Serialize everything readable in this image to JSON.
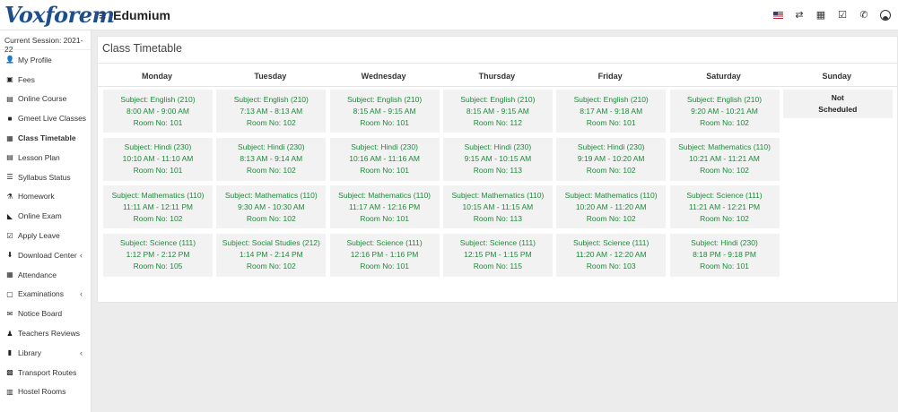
{
  "app": {
    "logo": "Voxforem",
    "title": "Edumium"
  },
  "topbar_icons": [
    "us-flag-icon",
    "swap-icon",
    "calendar-icon",
    "checkbox-icon",
    "whatsapp-icon",
    "user-avatar-icon"
  ],
  "sidebar": {
    "session": "Current Session: 2021-22",
    "items": [
      {
        "label": "My Profile",
        "icon": "user-icon",
        "glyph": "👤"
      },
      {
        "label": "Fees",
        "icon": "fees-icon",
        "glyph": "▣"
      },
      {
        "label": "Online Course",
        "icon": "course-icon",
        "glyph": "▤"
      },
      {
        "label": "Gmeet Live Classes",
        "icon": "video-icon",
        "glyph": "■"
      },
      {
        "label": "Class Timetable",
        "icon": "timetable-icon",
        "glyph": "▦",
        "active": true
      },
      {
        "label": "Lesson Plan",
        "icon": "lesson-plan-icon",
        "glyph": "▤"
      },
      {
        "label": "Syllabus Status",
        "icon": "list-icon",
        "glyph": "☰"
      },
      {
        "label": "Homework",
        "icon": "flask-icon",
        "glyph": "⚗"
      },
      {
        "label": "Online Exam",
        "icon": "rss-icon",
        "glyph": "◣"
      },
      {
        "label": "Apply Leave",
        "icon": "check-square-icon",
        "glyph": "☑"
      },
      {
        "label": "Download Center",
        "icon": "download-icon",
        "glyph": "⬇",
        "chevron": "‹"
      },
      {
        "label": "Attendance",
        "icon": "calendar-check-icon",
        "glyph": "▦"
      },
      {
        "label": "Examinations",
        "icon": "map-icon",
        "glyph": "▢",
        "chevron": "‹"
      },
      {
        "label": "Notice Board",
        "icon": "envelope-icon",
        "glyph": "✉"
      },
      {
        "label": "Teachers Reviews",
        "icon": "teacher-icon",
        "glyph": "♟"
      },
      {
        "label": "Library",
        "icon": "book-icon",
        "glyph": "▮",
        "chevron": "‹"
      },
      {
        "label": "Transport Routes",
        "icon": "bus-icon",
        "glyph": "▩"
      },
      {
        "label": "Hostel Rooms",
        "icon": "building-icon",
        "glyph": "▥"
      }
    ]
  },
  "timetable": {
    "title": "Class Timetable",
    "days": [
      "Monday",
      "Tuesday",
      "Wednesday",
      "Thursday",
      "Friday",
      "Saturday",
      "Sunday"
    ],
    "columns": [
      [
        [
          "Subject: English (210)",
          "8:00 AM - 9:00 AM",
          "Room No: 101"
        ],
        [
          "Subject: Hindi (230)",
          "10:10 AM - 11:10 AM",
          "Room No: 101"
        ],
        [
          "Subject: Mathematics (110)",
          "11:11 AM - 12:11 PM",
          "Room No: 102"
        ],
        [
          "Subject: Science (111)",
          "1:12 PM - 2:12 PM",
          "Room No: 105"
        ]
      ],
      [
        [
          "Subject: English (210)",
          "7:13 AM - 8:13 AM",
          "Room No: 102"
        ],
        [
          "Subject: Hindi (230)",
          "8:13 AM - 9:14 AM",
          "Room No: 102"
        ],
        [
          "Subject: Mathematics (110)",
          "9:30 AM - 10:30 AM",
          "Room No: 102"
        ],
        [
          "Subject: Social Studies (212)",
          "1:14 PM - 2:14 PM",
          "Room No: 102"
        ]
      ],
      [
        [
          "Subject: English (210)",
          "8:15 AM - 9:15 AM",
          "Room No: 101"
        ],
        [
          "Subject: Hindi (230)",
          "10:16 AM - 11:16 AM",
          "Room No: 101"
        ],
        [
          "Subject: Mathematics (110)",
          "11:17 AM - 12:16 PM",
          "Room No: 101"
        ],
        [
          "Subject: Science (111)",
          "12:16 PM - 1:16 PM",
          "Room No: 101"
        ]
      ],
      [
        [
          "Subject: English (210)",
          "8:15 AM - 9:15 AM",
          "Room No: 112"
        ],
        [
          "Subject: Hindi (230)",
          "9:15 AM - 10:15 AM",
          "Room No: 113"
        ],
        [
          "Subject: Mathematics (110)",
          "10:15 AM - 11:15 AM",
          "Room No: 113"
        ],
        [
          "Subject: Science (111)",
          "12:15 PM - 1:15 PM",
          "Room No: 115"
        ]
      ],
      [
        [
          "Subject: English (210)",
          "8:17 AM - 9:18 AM",
          "Room No: 101"
        ],
        [
          "Subject: Hindi (230)",
          "9:19 AM - 10:20 AM",
          "Room No: 102"
        ],
        [
          "Subject: Mathematics (110)",
          "10:20 AM - 11:20 AM",
          "Room No: 102"
        ],
        [
          "Subject: Science (111)",
          "11:20 AM - 12:20 AM",
          "Room No: 103"
        ]
      ],
      [
        [
          "Subject: English (210)",
          "9:20 AM - 10:21 AM",
          "Room No: 102"
        ],
        [
          "Subject: Mathematics (110)",
          "10:21 AM - 11:21 AM",
          "Room No: 102"
        ],
        [
          "Subject: Science (111)",
          "11:21 AM - 12:21 PM",
          "Room No: 102"
        ],
        [
          "Subject: Hindi (230)",
          "8:18 PM - 9:18 PM",
          "Room No: 101"
        ]
      ],
      [
        [
          "Not",
          "Scheduled"
        ]
      ]
    ]
  }
}
